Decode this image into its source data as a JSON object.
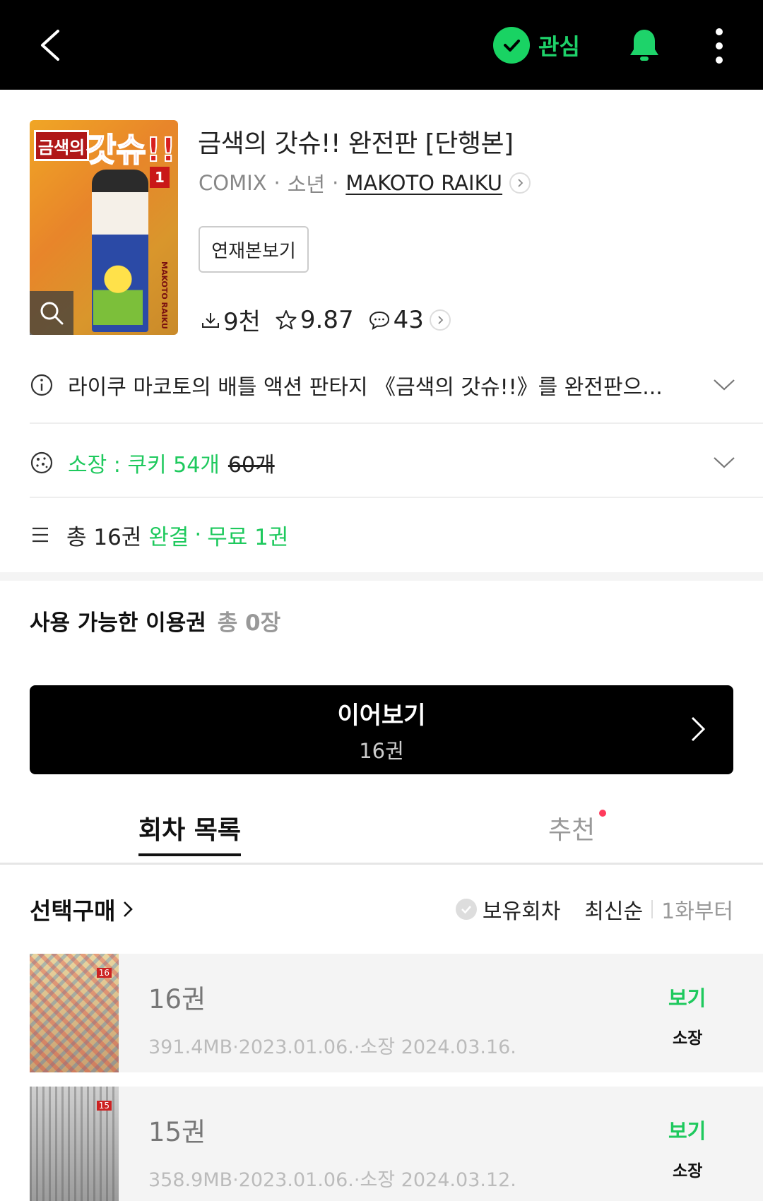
{
  "topbar": {
    "favorite_label": "관심",
    "accent_color": "#1ED36A"
  },
  "book": {
    "title": "금색의 갓슈!! 완전판 [단행본]",
    "category": "COMIX",
    "genre": "소년",
    "author": "MAKOTO RAIKU",
    "serial_button": "연재본보기",
    "cover_text": {
      "title": "갓슈!!",
      "subtitle": "금색의",
      "volume": "1",
      "author": "MAKOTO RAIKU"
    },
    "stats": {
      "downloads": "9천",
      "rating": "9.87",
      "comments": "43"
    }
  },
  "description": "라이쿠 마코토의 배틀 액션 판타지 《금색의 갓슈!!》를 완전판으...",
  "ownership": {
    "label": "소장 : 쿠키 54개",
    "original_price": "60개"
  },
  "summary": {
    "total": "총 16권",
    "status": "완결",
    "separator": "·",
    "free": "무료 1권"
  },
  "coupons": {
    "label": "사용 가능한 이용권",
    "count": "총 0장"
  },
  "continue_button": {
    "label": "이어보기",
    "volume": "16권"
  },
  "tabs": [
    {
      "label": "회차 목록",
      "active": true
    },
    {
      "label": "추천",
      "active": false,
      "has_badge": true
    }
  ],
  "list_header": {
    "select_buy": "선택구매",
    "owned_filter": "보유회차",
    "sort_newest": "최신순",
    "sort_first": "1화부터"
  },
  "episodes": [
    {
      "title": "16권",
      "info": "391.4MB·2023.01.06.·소장 2024.03.16.",
      "view_label": "보기",
      "owned_label": "소장",
      "thumb_number": "16"
    },
    {
      "title": "15권",
      "info": "358.9MB·2023.01.06.·소장 2024.03.12.",
      "view_label": "보기",
      "owned_label": "소장",
      "thumb_number": "15"
    }
  ]
}
